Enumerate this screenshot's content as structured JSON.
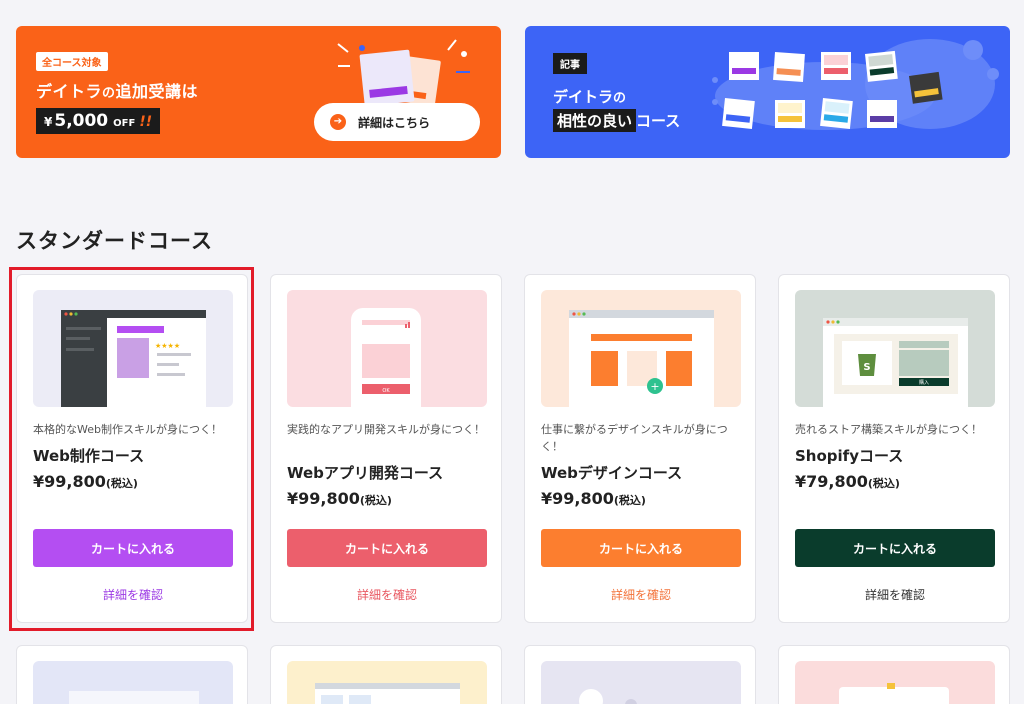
{
  "banner_campaign": {
    "tag": "全コース対象",
    "title_prefix": "デイトラ",
    "title_mid": "の",
    "title_suffix": "追加受講は",
    "price_yen": "¥",
    "price_amount": "5,000",
    "price_off": "OFF",
    "price_bang": "!!",
    "button_label": "詳細はこちら",
    "color": "#fa6218"
  },
  "banner_article": {
    "tag": "記事",
    "line1_prefix": "デイトラ",
    "line1_suffix": "の",
    "line2_highlight": "相性の良い",
    "line2_suffix": "コース",
    "color": "#3d64f6"
  },
  "section_title": "スタンダードコース",
  "courses": [
    {
      "desc": "本格的なWeb制作スキルが身につく！",
      "name": "Web制作コース",
      "price": "¥99,800",
      "tax": "(税込)",
      "cart_label": "カートに入れる",
      "more_label": "詳細を確認",
      "accent": "#b44ef2",
      "selected": true
    },
    {
      "desc": "実践的なアプリ開発スキルが身につく！",
      "name": "Webアプリ開発コース",
      "price": "¥99,800",
      "tax": "(税込)",
      "cart_label": "カートに入れる",
      "more_label": "詳細を確認",
      "accent": "#ec5f6c"
    },
    {
      "desc": "仕事に繋がるデザインスキルが身につく！",
      "name": "Webデザインコース",
      "price": "¥99,800",
      "tax": "(税込)",
      "cart_label": "カートに入れる",
      "more_label": "詳細を確認",
      "accent": "#fc7e2f"
    },
    {
      "desc": "売れるストア構築スキルが身につく！",
      "name": "Shopifyコース",
      "price": "¥79,800",
      "tax": "(税込)",
      "cart_label": "カートに入れる",
      "more_label": "詳細を確認",
      "accent": "#0a3c2c",
      "thumb_button": "購入"
    }
  ],
  "thumb_ok_label": "OK"
}
